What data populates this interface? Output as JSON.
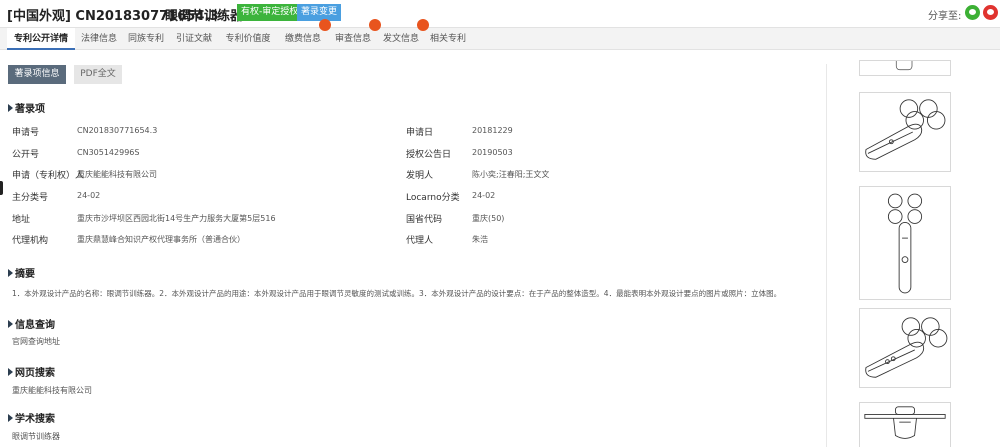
{
  "header": {
    "title": "[中国外观] CN201830771654.3",
    "name": "眼调节训练器",
    "status_badge": "有权-审定授权",
    "change_badge": "著录变更",
    "share_label": "分享至:",
    "colors": {
      "status": "#3cb43c",
      "change": "#4a9fe0",
      "accent": "#3b6fb6"
    }
  },
  "tabs": [
    {
      "label": "专利公开详情"
    },
    {
      "label": "法律信息"
    },
    {
      "label": "同族专利"
    },
    {
      "label": "引证文献"
    },
    {
      "label": "专利价值度"
    },
    {
      "label": "缴费信息"
    },
    {
      "label": "审查信息"
    },
    {
      "label": "发文信息"
    },
    {
      "label": "相关专利"
    }
  ],
  "subtabs": {
    "biblio": "著录项信息",
    "pdf": "PDF全文"
  },
  "sections": {
    "biblio": "著录项",
    "abstract": "摘要",
    "info": "信息查询",
    "web": "网页搜索",
    "academic": "学术搜索"
  },
  "fields": {
    "app_no": {
      "label": "申请号",
      "value": "CN201830771654.3"
    },
    "app_date": {
      "label": "申请日",
      "value": "20181229"
    },
    "pub_no": {
      "label": "公开号",
      "value": "CN305142996S"
    },
    "grant_date": {
      "label": "授权公告日",
      "value": "20190503"
    },
    "applicant": {
      "label": "申请（专利权）人",
      "value": "重庆能能科技有限公司"
    },
    "inventor": {
      "label": "发明人",
      "value": "陈小奕;汪春阳;王文文"
    },
    "main_class": {
      "label": "主分类号",
      "value": "24-02"
    },
    "locarno": {
      "label": "Locarno分类",
      "value": "24-02"
    },
    "address": {
      "label": "地址",
      "value": "重庆市沙坪坝区西园北街14号生产力服务大厦第5层516"
    },
    "province": {
      "label": "国省代码",
      "value": "重庆(50)"
    },
    "agency": {
      "label": "代理机构",
      "value": "重庆鼎慧峰合知识产权代理事务所（普通合伙）"
    },
    "agent": {
      "label": "代理人",
      "value": "朱浩"
    }
  },
  "abstract_text": "1．本外观设计产品的名称：眼调节训练器。2．本外观设计产品的用途：本外观设计产品用于眼调节灵敏度的测试或训练。3．本外观设计产品的设计要点：在于产品的整体造型。4．最能表明本外观设计要点的图片或照片：立体图。",
  "info_text": "官网查询地址",
  "web_text": "重庆能能科技有限公司",
  "academic_text": "眼调节训练器"
}
